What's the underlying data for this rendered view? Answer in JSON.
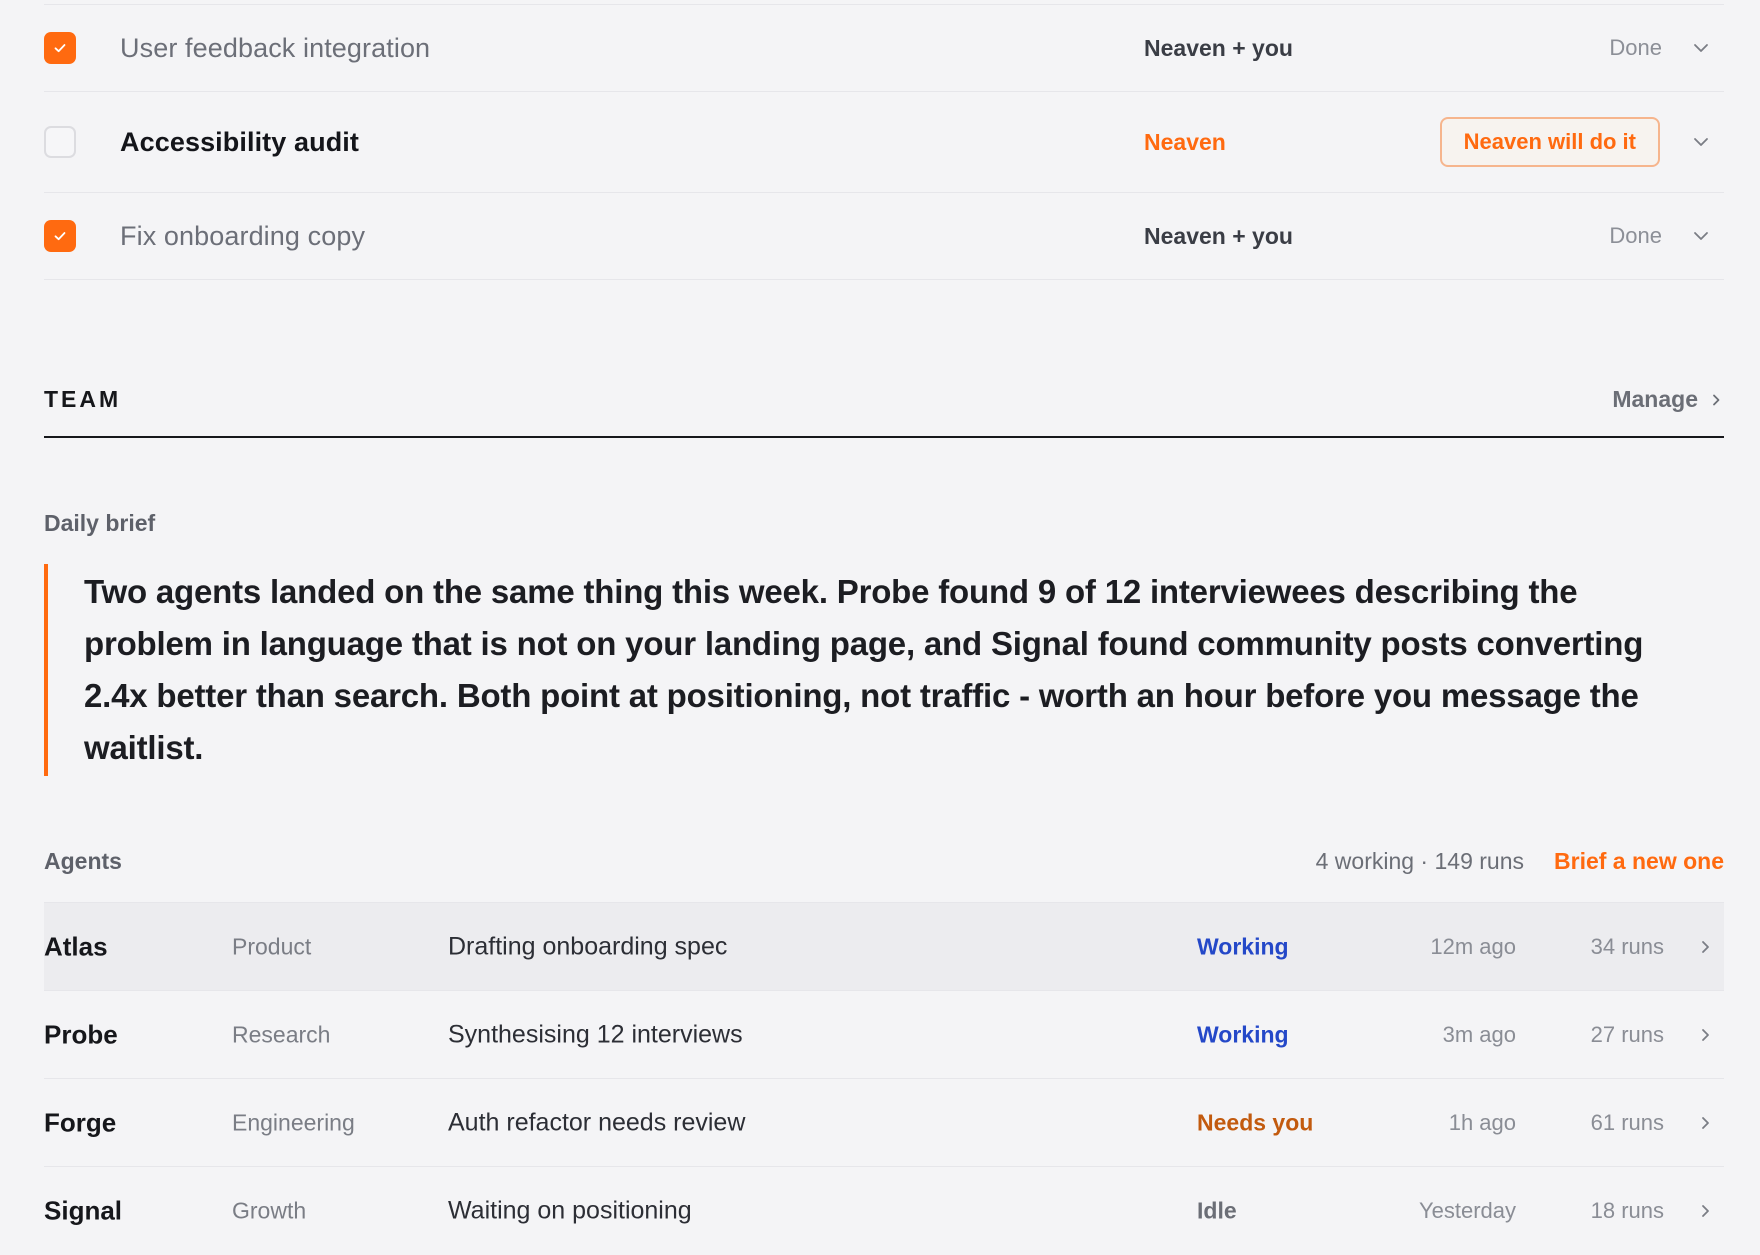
{
  "tasks": [
    {
      "title": "User feedback integration",
      "owner": "Neaven + you",
      "status": "Done",
      "checked": true
    },
    {
      "title": "Accessibility audit",
      "owner": "Neaven",
      "action": "Neaven will do it",
      "checked": false
    },
    {
      "title": "Fix onboarding copy",
      "owner": "Neaven + you",
      "status": "Done",
      "checked": true
    }
  ],
  "team": {
    "title": "TEAM",
    "manage_label": "Manage"
  },
  "daily_brief": {
    "label": "Daily brief",
    "text": "Two agents landed on the same thing this week. Probe found 9 of 12 interviewees describing the problem in language that is not on your landing page, and Signal found community posts converting 2.4x better than search. Both point at positioning, not traffic - worth an hour before you message the waitlist."
  },
  "agents": {
    "title": "Agents",
    "summary": "4 working · 149 runs",
    "new_link": "Brief a new one",
    "rows": [
      {
        "name": "Atlas",
        "dept": "Product",
        "task": "Drafting onboarding spec",
        "status": "Working",
        "time": "12m ago",
        "runs": "34 runs"
      },
      {
        "name": "Probe",
        "dept": "Research",
        "task": "Synthesising 12 interviews",
        "status": "Working",
        "time": "3m ago",
        "runs": "27 runs"
      },
      {
        "name": "Forge",
        "dept": "Engineering",
        "task": "Auth refactor needs review",
        "status": "Needs you",
        "time": "1h ago",
        "runs": "61 runs"
      },
      {
        "name": "Signal",
        "dept": "Growth",
        "task": "Waiting on positioning",
        "status": "Idle",
        "time": "Yesterday",
        "runs": "18 runs"
      }
    ]
  },
  "colors": {
    "accent": "#ff6a10",
    "working": "#2448c8",
    "needs_you": "#c25a0e",
    "background": "#f4f4f6"
  },
  "icons": {
    "check": "check-icon",
    "chevron_down": "chevron-down-icon",
    "chevron_right": "chevron-right-icon"
  }
}
